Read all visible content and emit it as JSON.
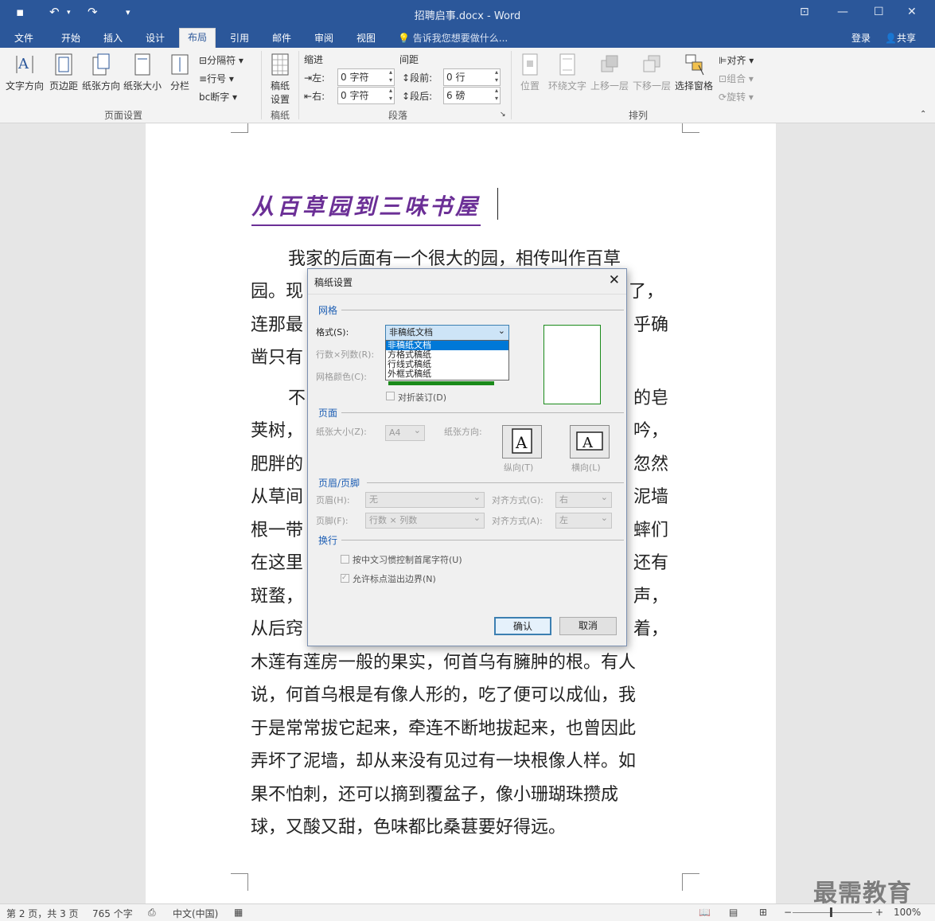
{
  "window": {
    "title": "招聘启事.docx - Word",
    "login": "登录",
    "share": "共享"
  },
  "tabs": [
    "文件",
    "开始",
    "插入",
    "设计",
    "布局",
    "引用",
    "邮件",
    "审阅",
    "视图"
  ],
  "active_tab": "布局",
  "tellme": "告诉我您想要做什么...",
  "ribbon": {
    "page_setup": {
      "text_dir": "文字方向",
      "margins": "页边距",
      "orientation": "纸张方向",
      "size": "纸张大小",
      "columns": "分栏",
      "breaks": "分隔符",
      "line_numbers": "行号",
      "hyphenation": "断字",
      "label": "页面设置"
    },
    "manuscript": {
      "btn1": "稿纸",
      "btn2": "设置",
      "label": "稿纸"
    },
    "paragraph": {
      "indent": "缩进",
      "spacing": "间距",
      "left_label": "左:",
      "right_label": "右:",
      "before_label": "段前:",
      "after_label": "段后:",
      "left": "0 字符",
      "right": "0 字符",
      "before": "0 行",
      "after": "6 磅",
      "label": "段落"
    },
    "arrange": {
      "position": "位置",
      "wrap": "环绕文字",
      "forward": "上移一层",
      "backward": "下移一层",
      "pane": "选择窗格",
      "align": "对齐",
      "group": "组合",
      "rotate": "旋转",
      "label": "排列"
    }
  },
  "document": {
    "title": "从百草园到三味书屋",
    "lines": [
      "我家的后面有一个很大的园，相传叫作百草",
      "园。现",
      "了，",
      "连那最",
      "乎确",
      "凿只有",
      "不",
      "的皂",
      "荚树，",
      "吟，",
      "肥胖的",
      "忽然",
      "从草间",
      "泥墙",
      "根一带",
      "蟀们",
      "在这里",
      "还有",
      "斑蝥，",
      "声，",
      "从后窍",
      "着，",
      "木莲有莲房一般的果实，何首乌有臃肿的根。有人",
      "说，何首乌根是有像人形的，吃了便可以成仙，我",
      "于是常常拔它起来，牵连不断地拔起来，也曾因此",
      "弄坏了泥墙，却从来没有见过有一块根像人样。如",
      "果不怕刺，还可以摘到覆盆子，像小珊瑚珠攒成",
      "球，又酸又甜，色味都比桑葚要好得远。"
    ]
  },
  "dialog": {
    "title": "稿纸设置",
    "grid_section": "网格",
    "format_label": "格式(S):",
    "format_value": "非稿纸文档",
    "format_options": [
      "非稿纸文档",
      "方格式稿纸",
      "行线式稿纸",
      "外框式稿纸"
    ],
    "rows_cols_label": "行数×列数(R):",
    "grid_color_label": "网格颜色(C):",
    "fold_label": "对折装订(D)",
    "page_section": "页面",
    "paper_size_label": "纸张大小(Z):",
    "paper_size_value": "A4",
    "orientation_label": "纸张方向:",
    "portrait": "纵向(T)",
    "landscape": "横向(L)",
    "hf_section": "页眉/页脚",
    "header_label": "页眉(H):",
    "header_value": "无",
    "footer_label": "页脚(F):",
    "footer_value": "行数 × 列数",
    "align_g_label": "对齐方式(G):",
    "align_g_value": "右",
    "align_a_label": "对齐方式(A):",
    "align_a_value": "左",
    "wrap_section": "换行",
    "wrap_opt1": "按中文习惯控制首尾字符(U)",
    "wrap_opt2": "允许标点溢出边界(N)",
    "ok": "确认",
    "cancel": "取消"
  },
  "status": {
    "page": "第 2 页，共 3 页",
    "words": "765 个字",
    "lang": "中文(中国)",
    "zoom": "100%"
  },
  "watermark": "最需教育"
}
